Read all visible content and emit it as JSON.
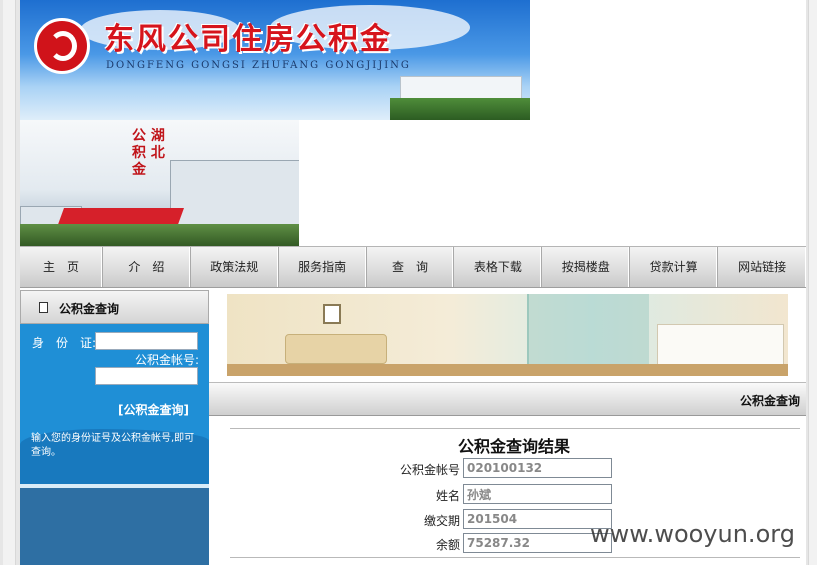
{
  "header": {
    "title": "东风公司住房公积金",
    "subtitle": "DONGFENG GONGSI ZHUFANG GONGJIJING",
    "stamp_text": "湖北公积金"
  },
  "nav": {
    "items": [
      {
        "label": "主　页",
        "width": 82
      },
      {
        "label": "介　绍",
        "width": 87
      },
      {
        "label": "政策法规",
        "width": 87
      },
      {
        "label": "服务指南",
        "width": 87
      },
      {
        "label": "查　询",
        "width": 87
      },
      {
        "label": "表格下载",
        "width": 87
      },
      {
        "label": "按揭楼盘",
        "width": 87
      },
      {
        "label": "贷款计算",
        "width": 87
      },
      {
        "label": "网站链接",
        "width": 88
      }
    ]
  },
  "sidebar": {
    "heading": "公积金查询",
    "id_label": "身　份　证:",
    "account_label": "公积金帐号:",
    "query_link": "[公积金查询]",
    "hint": "输入您的身份证号及公积金帐号,即可查询。"
  },
  "main": {
    "section_title": "公积金查询",
    "result_title": "公积金查询结果",
    "fields": [
      {
        "label": "公积金帐号",
        "value": "020100132"
      },
      {
        "label": "姓名",
        "value": "孙斌"
      },
      {
        "label": "缴交期",
        "value": "201504"
      },
      {
        "label": "余额",
        "value": "75287.32"
      }
    ]
  },
  "watermark": "www.wooyun.org",
  "colors": {
    "accent_red": "#d6141c",
    "panel_blue": "#1f8fd6"
  }
}
